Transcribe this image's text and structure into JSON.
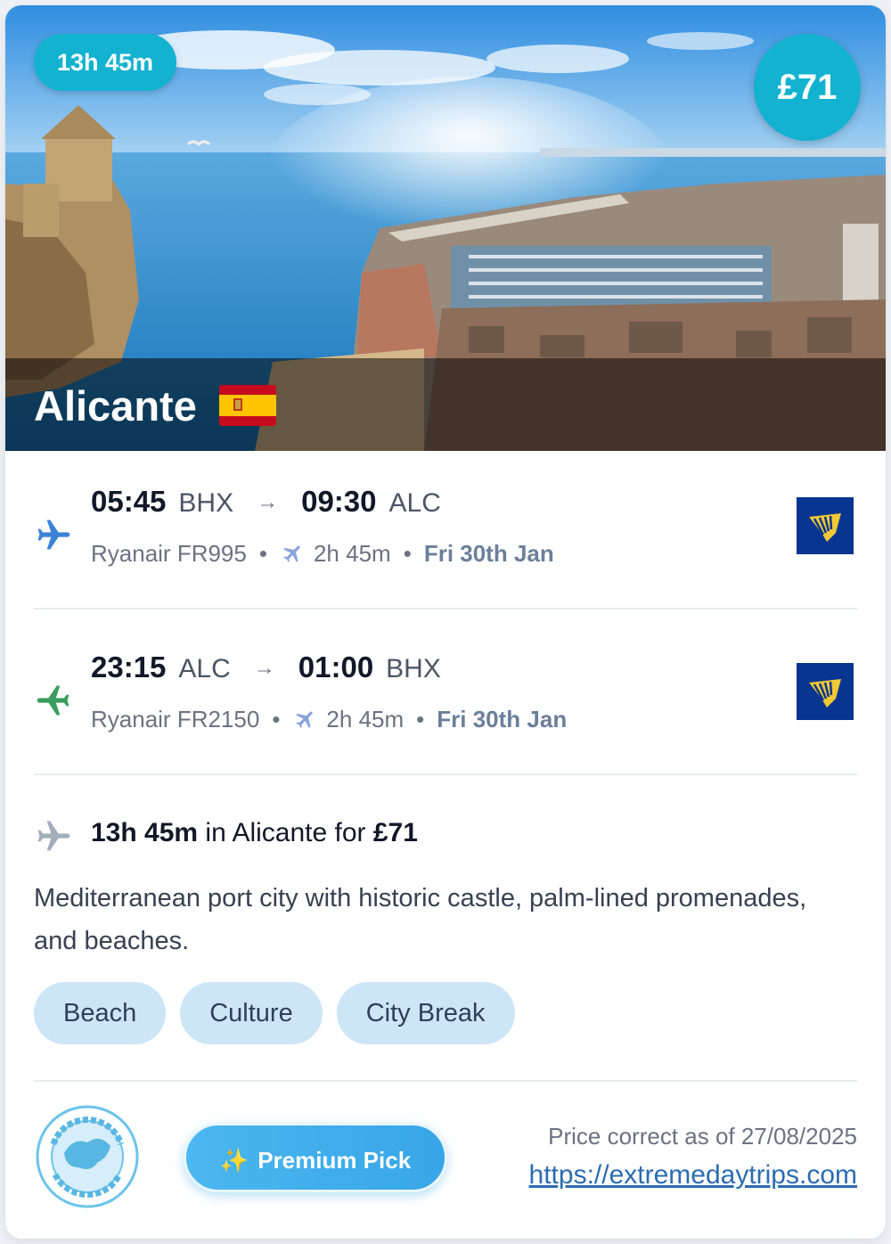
{
  "hero": {
    "duration_badge": "13h 45m",
    "price_badge": "£71",
    "city": "Alicante",
    "flag_icon": "spain-flag-icon"
  },
  "flights": [
    {
      "direction": "outbound",
      "icon": "plane-departure-icon",
      "icon_color": "#3b82d6",
      "depart_time": "05:45",
      "depart_code": "BHX",
      "arrow": "→",
      "arrive_time": "09:30",
      "arrive_code": "ALC",
      "airline_flight": "Ryanair FR995",
      "duration": "2h 45m",
      "date": "Fri 30th Jan",
      "airline_logo": "ryanair-logo"
    },
    {
      "direction": "return",
      "icon": "plane-arrival-icon",
      "icon_color": "#3a9d5d",
      "depart_time": "23:15",
      "depart_code": "ALC",
      "arrow": "→",
      "arrive_time": "01:00",
      "arrive_code": "BHX",
      "airline_flight": "Ryanair FR2150",
      "duration": "2h 45m",
      "date": "Fri 30th Jan",
      "airline_logo": "ryanair-logo"
    }
  ],
  "summary": {
    "duration": "13h 45m",
    "middle": " in Alicante for ",
    "price": "£71"
  },
  "description": "Mediterranean port city with historic castle, palm-lined promenades, and beaches.",
  "tags": [
    "Beach",
    "Culture",
    "City Break"
  ],
  "footer": {
    "logo_icon": "extreme-day-trips-logo",
    "premium_icon": "✨",
    "premium_label": "Premium Pick",
    "price_note": "Price correct as of 27/08/2025",
    "link": "https://extremedaytrips.com"
  },
  "colors": {
    "accent": "#12b2d0",
    "tag_bg": "#cde6f7",
    "premium": "#3ea9ea",
    "ryanair_blue": "#073590",
    "ryanair_gold": "#f1c933"
  }
}
